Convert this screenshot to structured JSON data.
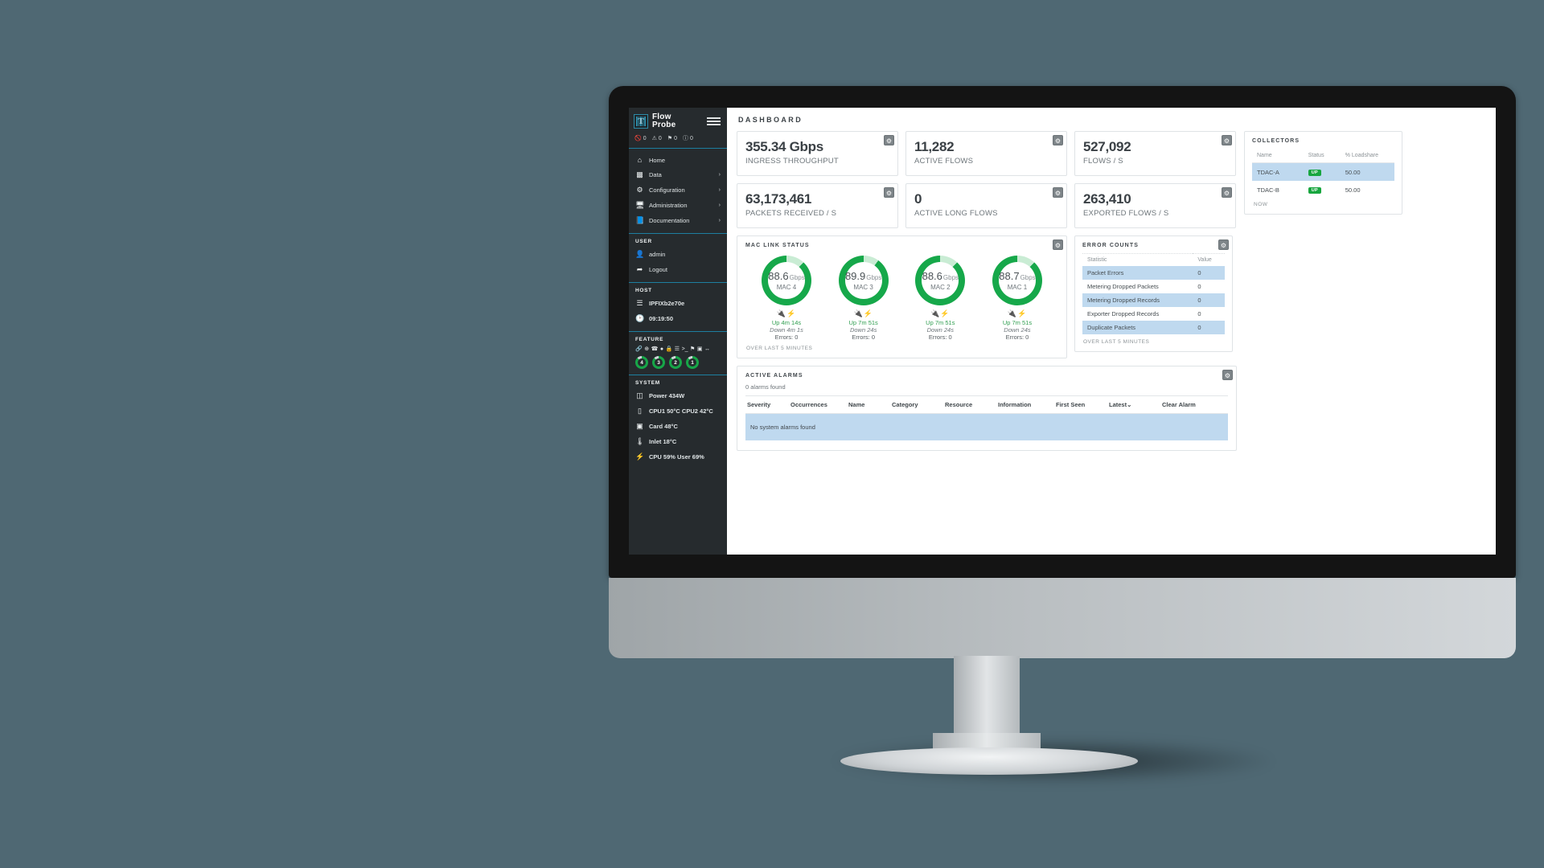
{
  "brand": {
    "line1": "Flow",
    "line2": "Probe",
    "logo_letter": "T",
    "logo_icon": "barcode-logo-icon",
    "menu_icon": "hamburger-icon"
  },
  "status_counters": [
    {
      "icon": "ban-icon",
      "value": "0"
    },
    {
      "icon": "warning-triangle-icon",
      "value": "0"
    },
    {
      "icon": "flag-icon",
      "value": "0"
    },
    {
      "icon": "info-circle-icon",
      "value": "0"
    }
  ],
  "nav": [
    {
      "label": "Home",
      "icon": "home-icon",
      "chevron": ""
    },
    {
      "label": "Data",
      "icon": "chart-bar-icon",
      "chevron": "›"
    },
    {
      "label": "Configuration",
      "icon": "gears-icon",
      "chevron": "›"
    },
    {
      "label": "Administration",
      "icon": "desktop-icon",
      "chevron": "›"
    },
    {
      "label": "Documentation",
      "icon": "book-icon",
      "chevron": "›"
    }
  ],
  "sections": {
    "user": {
      "title": "USER",
      "items": [
        {
          "label": "admin",
          "icon": "user-icon"
        },
        {
          "label": "Logout",
          "icon": "sign-out-icon"
        }
      ]
    },
    "host": {
      "title": "HOST",
      "items": [
        {
          "label": "IPFIXb2e70e",
          "icon": "server-icon"
        },
        {
          "label": "09:19:50",
          "icon": "clock-icon"
        }
      ]
    },
    "feature": {
      "title": "FEATURE",
      "icons": [
        {
          "name": "link-icon",
          "glyph": "🔗"
        },
        {
          "name": "globe-icon",
          "glyph": "⊕"
        },
        {
          "name": "phone-icon",
          "glyph": "☎"
        },
        {
          "name": "circle-icon",
          "glyph": "●"
        },
        {
          "name": "lock-icon",
          "glyph": "🔒"
        },
        {
          "name": "list-icon",
          "glyph": "☰"
        },
        {
          "name": "terminal-icon",
          "glyph": ">_"
        },
        {
          "name": "flag-chart-icon",
          "glyph": "⚑"
        },
        {
          "name": "square-icon",
          "glyph": "▣"
        },
        {
          "name": "arrows-icon",
          "glyph": "↔"
        }
      ],
      "ports": [
        "4",
        "3",
        "2",
        "1"
      ]
    },
    "system": {
      "title": "SYSTEM",
      "items": [
        {
          "label": "Power 434W",
          "icon": "battery-icon"
        },
        {
          "label": "CPU1 50°C CPU2 42°C",
          "icon": "cpu-icon"
        },
        {
          "label": "Card 48°C",
          "icon": "card-icon"
        },
        {
          "label": "Inlet 18°C",
          "icon": "thermometer-icon"
        },
        {
          "label": "CPU 59% User 69%",
          "icon": "bolt-icon"
        }
      ]
    }
  },
  "page": {
    "title": "DASHBOARD"
  },
  "kpis": [
    {
      "value": "355.34 Gbps",
      "label": "INGRESS THROUGHPUT"
    },
    {
      "value": "11,282",
      "label": "ACTIVE FLOWS"
    },
    {
      "value": "527,092",
      "label": "FLOWS / S"
    },
    {
      "value": "63,173,461",
      "label": "PACKETS RECEIVED / S"
    },
    {
      "value": "0",
      "label": "ACTIVE LONG FLOWS"
    },
    {
      "value": "263,410",
      "label": "EXPORTED FLOWS / S"
    }
  ],
  "mac_link_status": {
    "title": "MAC LINK STATUS",
    "footer": "OVER LAST 5 MINUTES",
    "unit": "Gbps",
    "gauges": [
      {
        "value": "88.6",
        "name": "MAC 4",
        "percent": 88,
        "up": "Up 4m 14s",
        "down": "Down 4m 1s",
        "errors": "Errors: 0"
      },
      {
        "value": "89.9",
        "name": "MAC 3",
        "percent": 90,
        "up": "Up 7m 51s",
        "down": "Down 24s",
        "errors": "Errors: 0"
      },
      {
        "value": "88.6",
        "name": "MAC 2",
        "percent": 88,
        "up": "Up 7m 51s",
        "down": "Down 24s",
        "errors": "Errors: 0"
      },
      {
        "value": "88.7",
        "name": "MAC 1",
        "percent": 88,
        "up": "Up 7m 51s",
        "down": "Down 24s",
        "errors": "Errors: 0"
      }
    ]
  },
  "error_counts": {
    "title": "ERROR COUNTS",
    "footer": "OVER LAST 5 MINUTES",
    "columns": [
      "Statistic",
      "Value"
    ],
    "rows": [
      {
        "statistic": "Packet Errors",
        "value": "0"
      },
      {
        "statistic": "Metering Dropped Packets",
        "value": "0"
      },
      {
        "statistic": "Metering Dropped Records",
        "value": "0"
      },
      {
        "statistic": "Exporter Dropped Records",
        "value": "0"
      },
      {
        "statistic": "Duplicate Packets",
        "value": "0"
      }
    ]
  },
  "active_alarms": {
    "title": "ACTIVE ALARMS",
    "count_text": "0 alarms found",
    "columns": [
      "Severity",
      "Occurrences",
      "Name",
      "Category",
      "Resource",
      "Information",
      "First Seen",
      "Latest⌄",
      "Clear Alarm"
    ],
    "empty_text": "No system alarms found"
  },
  "collectors": {
    "title": "COLLECTORS",
    "footer": "NOW",
    "columns": [
      "Name",
      "Status",
      "% Loadshare"
    ],
    "rows": [
      {
        "name": "TDAC-A",
        "status": "UP",
        "loadshare": "50.00"
      },
      {
        "name": "TDAC-B",
        "status": "UP",
        "loadshare": "50.00"
      }
    ]
  },
  "colors": {
    "accent_teal": "#2c8aa6",
    "green": "#16a84a",
    "green_light": "#c9ecd4",
    "row_highlight": "#bfd9ef",
    "sidebar_bg": "#262b2e",
    "desktop_bg": "#4f6873",
    "red": "#e02a22"
  }
}
